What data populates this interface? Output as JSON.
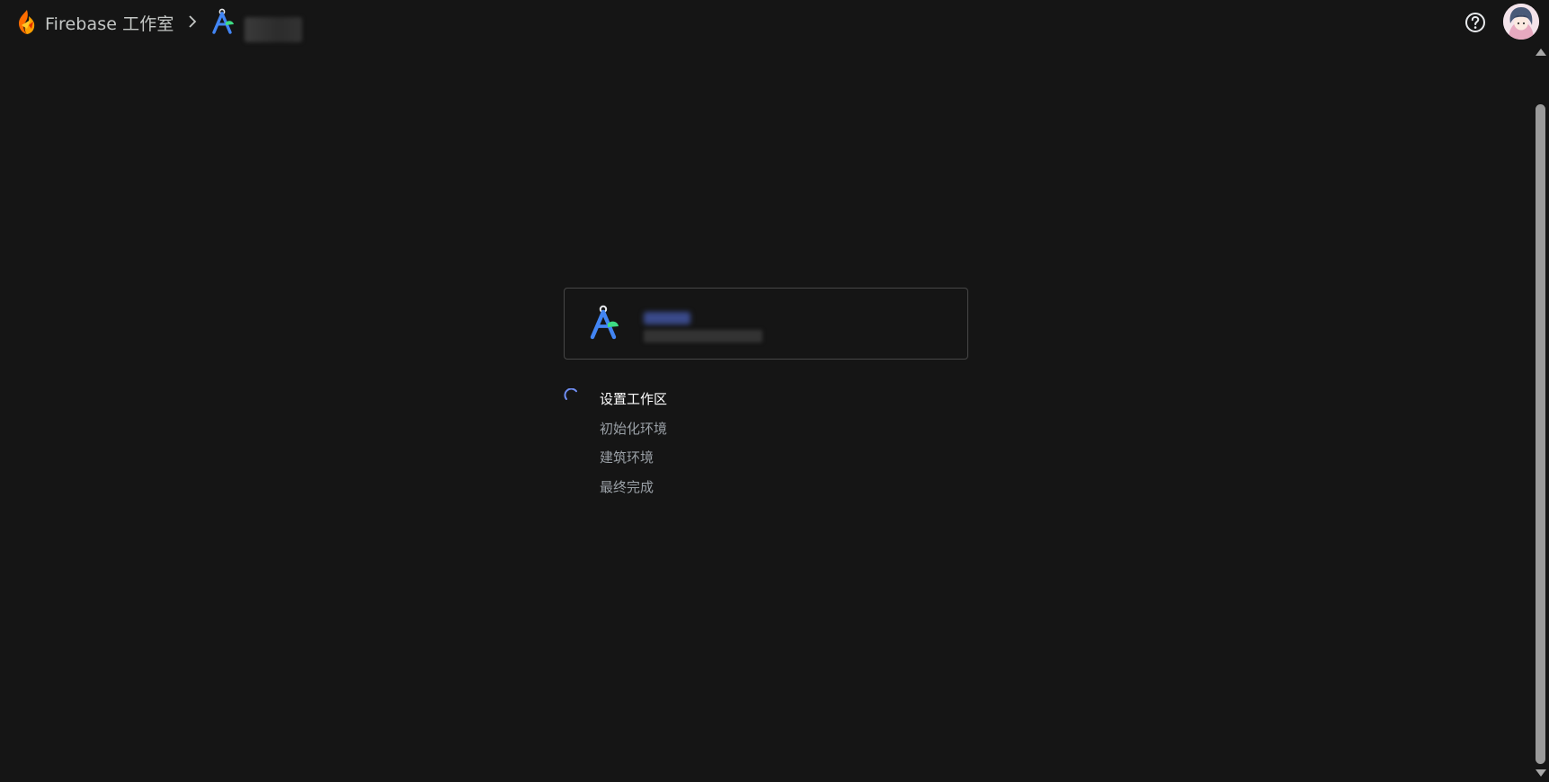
{
  "header": {
    "brand_text": "Firebase 工作室",
    "project_icon": "android-studio-icon",
    "help_icon": "help-circle-icon",
    "avatar_icon": "user-avatar"
  },
  "workspace_card": {
    "icon": "android-studio-icon"
  },
  "steps": [
    {
      "label": "设置工作区",
      "state": "in-progress"
    },
    {
      "label": "初始化环境",
      "state": "pending"
    },
    {
      "label": "建筑环境",
      "state": "pending"
    },
    {
      "label": "最终完成",
      "state": "pending"
    }
  ],
  "colors": {
    "background": "#151515",
    "accent": "#8ab4f8",
    "text_active": "#ffffff",
    "text_pending": "#9aa0a6",
    "card_border": "#474747"
  }
}
